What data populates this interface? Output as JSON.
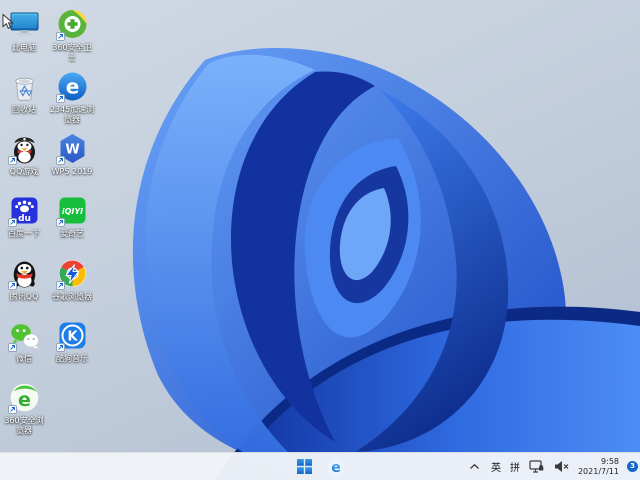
{
  "wallpaper": {
    "description": "Windows 11 blue bloom on light grey-blue background",
    "background_color": "#c3cedc",
    "petal_dark": "#0c2c8c",
    "petal_mid": "#2f6ae0",
    "petal_light": "#6aa3f8"
  },
  "desktop": {
    "icons": [
      {
        "label": "此电脑",
        "icon": "this-pc-icon",
        "shortcut": false
      },
      {
        "label": "360安全卫士",
        "icon": "360-safe-icon",
        "shortcut": true
      },
      {
        "label": "回收站",
        "icon": "recycle-bin-icon",
        "shortcut": false
      },
      {
        "label": "2345加速浏览器",
        "icon": "2345-browser-icon",
        "shortcut": true
      },
      {
        "label": "QQ游戏",
        "icon": "qq-games-icon",
        "shortcut": true
      },
      {
        "label": "WPS 2019",
        "icon": "wps-2019-icon",
        "shortcut": true
      },
      {
        "label": "百度一下",
        "icon": "baidu-icon",
        "shortcut": true
      },
      {
        "label": "爱奇艺",
        "icon": "iqiyi-icon",
        "shortcut": true
      },
      {
        "label": "腾讯QQ",
        "icon": "tencent-qq-icon",
        "shortcut": true
      },
      {
        "label": "谷歌浏览器",
        "icon": "chrome-icon",
        "shortcut": true
      },
      {
        "label": "微信",
        "icon": "wechat-icon",
        "shortcut": true
      },
      {
        "label": "酷狗音乐",
        "icon": "kugou-music-icon",
        "shortcut": true
      },
      {
        "label": "360安全浏览器",
        "icon": "360-browser-icon",
        "shortcut": true
      }
    ]
  },
  "taskbar": {
    "center_icons": [
      "start-icon",
      "browser-e-icon"
    ],
    "tray": {
      "icons": [
        "chevron-up-icon",
        "network-ethernet-icon",
        "volume-muted-icon"
      ],
      "ime_english": "英",
      "ime_pinyin": "拼"
    },
    "clock": {
      "time": "9:58",
      "date": "2021/7/11"
    },
    "notification_badge": "3",
    "colors": {
      "taskbar_bg": "#f1f4f8",
      "accent_blue": "#1566c8"
    }
  }
}
